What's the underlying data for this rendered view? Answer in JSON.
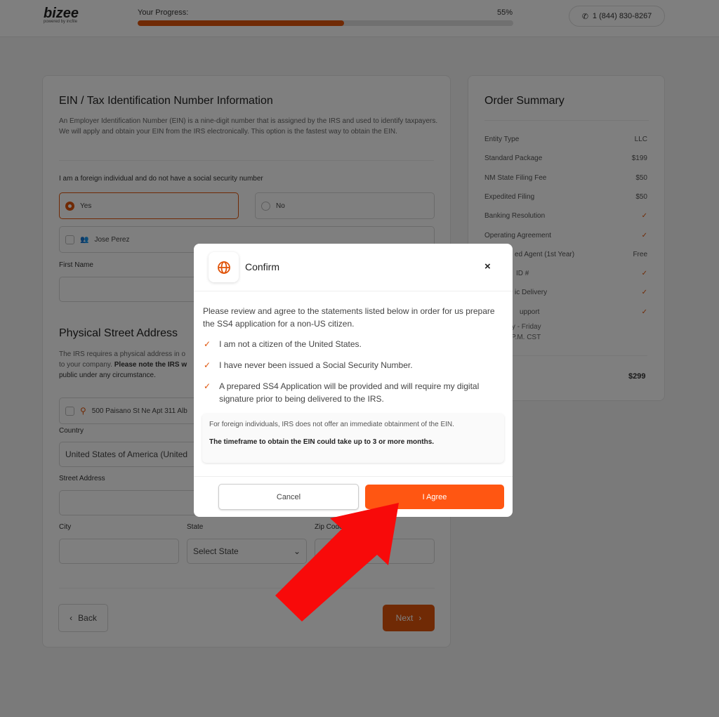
{
  "header": {
    "logo": "bizee",
    "logo_sub": "powered by incfile",
    "progress_label": "Your Progress:",
    "progress_percent": 55,
    "progress_text": "55%",
    "phone": "1 (844) 830-8267",
    "accent": "#e0540a"
  },
  "ein": {
    "title": "EIN / Tax Identification Number Information",
    "description": "An Employer Identification Number (EIN) is a nine-digit number that is assigned by the IRS and used to identify taxpayers. We will apply and obtain your EIN from the IRS electronically. This option is the fastest way to obtain the EIN.",
    "question": "I am a foreign individual and do not have a social security number",
    "yes": "Yes",
    "no": "No",
    "person": "Jose Perez",
    "first_name_label": "First Name"
  },
  "address": {
    "title": "Physical Street Address",
    "desc1": "The IRS requires a physical address in o",
    "desc2": "to your company.",
    "desc_bold": "Please note the IRS w",
    "desc3": "public under any circumstance.",
    "saved": "500 Paisano St Ne Apt 311 Alb",
    "country_label": "Country",
    "country_value": "United States of America (United",
    "street_label": "Street Address",
    "city_label": "City",
    "state_label": "State",
    "state_placeholder": "Select State",
    "zip_label": "Zip Code"
  },
  "nav": {
    "back": "Back",
    "next": "Next"
  },
  "summary": {
    "title": "Order Summary",
    "rows": [
      {
        "label": "Entity Type",
        "value": "LLC"
      },
      {
        "label": "Standard Package",
        "value": "$199"
      },
      {
        "label": "NM State Filing Fee",
        "value": "$50"
      },
      {
        "label": "Expedited Filing",
        "value": "$50"
      },
      {
        "label": "Banking Resolution",
        "value": "✓"
      },
      {
        "label": "Operating Agreement",
        "value": "✓"
      },
      {
        "label": "ed Agent (1st Year)",
        "value": "Free"
      },
      {
        "label": "ID #",
        "value": "✓"
      },
      {
        "label": "ic Delivery",
        "value": "✓"
      },
      {
        "label": "upport",
        "value": "✓"
      }
    ],
    "hours1": "e Monday - Friday",
    "hours2": ".M. To 6 P.M. CST",
    "total": "$299"
  },
  "modal": {
    "title": "Confirm",
    "close": "×",
    "intro": "Please review and agree to the statements listed below in order for us prepare the SS4 application for a non-US citizen.",
    "statements": [
      "I am not a citizen of the United States.",
      "I have never been issued a Social Security Number.",
      "A prepared SS4 Application will be provided and will require my digital signature prior to being delivered to the IRS."
    ],
    "note": "For foreign individuals, IRS does not offer an immediate obtainment of the EIN.",
    "note_bold": "The timeframe to obtain the EIN could take up to 3 or more months.",
    "cancel": "Cancel",
    "agree": "I Agree"
  }
}
